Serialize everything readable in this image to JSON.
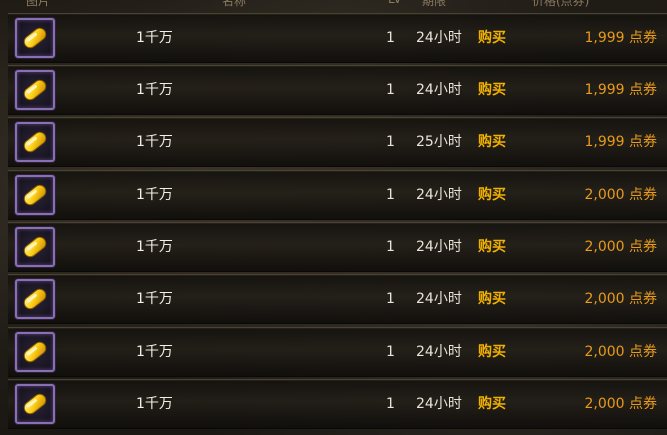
{
  "header": {
    "image": "图片",
    "name": "名称",
    "lv": "LV",
    "duration": "期限",
    "price": "价格(点券)"
  },
  "rows": [
    {
      "name": "1千万",
      "lv": "1",
      "duration": "24小时",
      "buy": "购买",
      "price": "1,999 点券"
    },
    {
      "name": "1千万",
      "lv": "1",
      "duration": "24小时",
      "buy": "购买",
      "price": "1,999 点券"
    },
    {
      "name": "1千万",
      "lv": "1",
      "duration": "25小时",
      "buy": "购买",
      "price": "1,999 点券"
    },
    {
      "name": "1千万",
      "lv": "1",
      "duration": "24小时",
      "buy": "购买",
      "price": "2,000 点券"
    },
    {
      "name": "1千万",
      "lv": "1",
      "duration": "24小时",
      "buy": "购买",
      "price": "2,000 点券"
    },
    {
      "name": "1千万",
      "lv": "1",
      "duration": "24小时",
      "buy": "购买",
      "price": "2,000 点券"
    },
    {
      "name": "1千万",
      "lv": "1",
      "duration": "24小时",
      "buy": "购买",
      "price": "2,000 点券"
    },
    {
      "name": "1千万",
      "lv": "1",
      "duration": "24小时",
      "buy": "购买",
      "price": "2,000 点券"
    }
  ],
  "icon": "gold-bar-icon",
  "colors": {
    "buy": "#f0b000",
    "price": "#e89a1a",
    "icon_border": "#8a6fb5"
  }
}
